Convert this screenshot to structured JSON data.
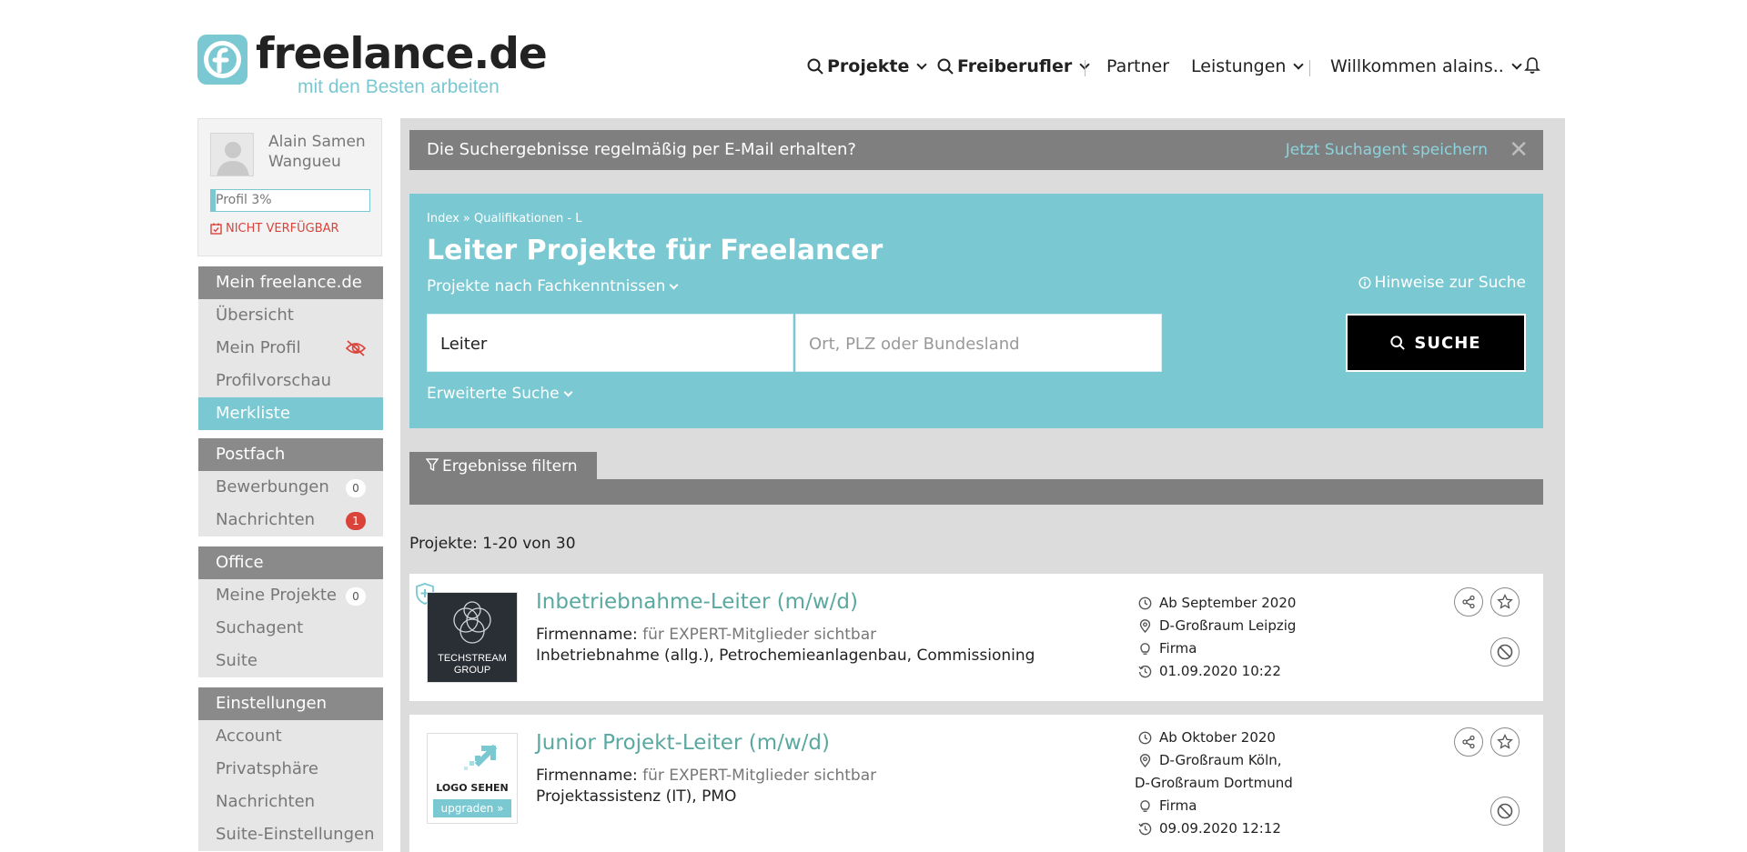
{
  "brand": {
    "name": "freelance.de",
    "tagline": "mit den Besten arbeiten",
    "accent": "#7ac8d2"
  },
  "topnav": {
    "projects": "Projekte",
    "freelancers": "Freiberufler",
    "partner": "Partner",
    "services": "Leistungen",
    "welcome": "Willkommen alains..",
    "icons": [
      "search-icon",
      "chevron-down-icon",
      "bell-icon"
    ]
  },
  "profile": {
    "name": "Alain Samen Wangueu",
    "progress_label": "Profil 3%",
    "progress": 3,
    "status": "NICHT VERFÜGBAR"
  },
  "sidebar": {
    "groups": [
      {
        "title": "Mein freelance.de",
        "items": [
          {
            "label": "Übersicht"
          },
          {
            "label": "Mein Profil"
          },
          {
            "label": "Profilvorschau"
          },
          {
            "label": "Merkliste",
            "active": true
          }
        ]
      },
      {
        "title": "Postfach",
        "items": [
          {
            "label": "Bewerbungen",
            "count": "0"
          },
          {
            "label": "Nachrichten",
            "count": "1"
          }
        ]
      },
      {
        "title": "Office",
        "items": [
          {
            "label": "Meine Projekte",
            "count": "0"
          },
          {
            "label": "Suchagent"
          },
          {
            "label": "Suite"
          }
        ]
      },
      {
        "title": "Einstellungen",
        "items": [
          {
            "label": "Account"
          },
          {
            "label": "Privatsphäre"
          },
          {
            "label": "Nachrichten"
          },
          {
            "label": "Suite-Einstellungen"
          }
        ]
      }
    ]
  },
  "notice": {
    "text": "Die Suchergebnisse regelmäßig per E-Mail erhalten?",
    "link": "Jetzt Suchagent speichern",
    "close": "✕"
  },
  "search": {
    "breadcrumb": "Index » Qualifikationen - L",
    "title": "Leiter Projekte für Freelancer",
    "by_skills": "Projekte nach Fachkenntnissen",
    "hints": "Hinweise zur Suche",
    "query_value": "Leiter",
    "location_placeholder": "Ort, PLZ oder Bundesland",
    "button": "SUCHE",
    "advanced": "Erweiterte Suche"
  },
  "filter": {
    "label": "Ergebnisse filtern"
  },
  "results": {
    "summary": "Projekte: 1-20 von 30",
    "items": [
      {
        "title": "Inbetriebnahme-Leiter (m/w/d)",
        "company_label": "Firmenname:",
        "company_value": "für EXPERT-Mitglieder sichtbar",
        "skills": "Inbetriebnahme (allg.), Petrochemieanlagenbau, Commissioning",
        "logo_text_1": "TECHSTREAM",
        "logo_text_2": "GROUP",
        "start": "Ab September 2020",
        "location_1": "D-Großraum Leipzig",
        "location_2": "",
        "type": "Firma",
        "date": "01.09.2020 10:22"
      },
      {
        "title": "Junior Projekt-Leiter (m/w/d)",
        "company_label": "Firmenname:",
        "company_value": "für EXPERT-Mitglieder sichtbar",
        "skills": "Projektassistenz (IT), PMO",
        "logo_text_1": "LOGO SEHEN",
        "logo_text_2": "upgraden »",
        "start": "Ab Oktober 2020",
        "location_1": "D-Großraum Köln,",
        "location_2": "D-Großraum Dortmund",
        "type": "Firma",
        "date": "09.09.2020 12:12"
      }
    ]
  }
}
